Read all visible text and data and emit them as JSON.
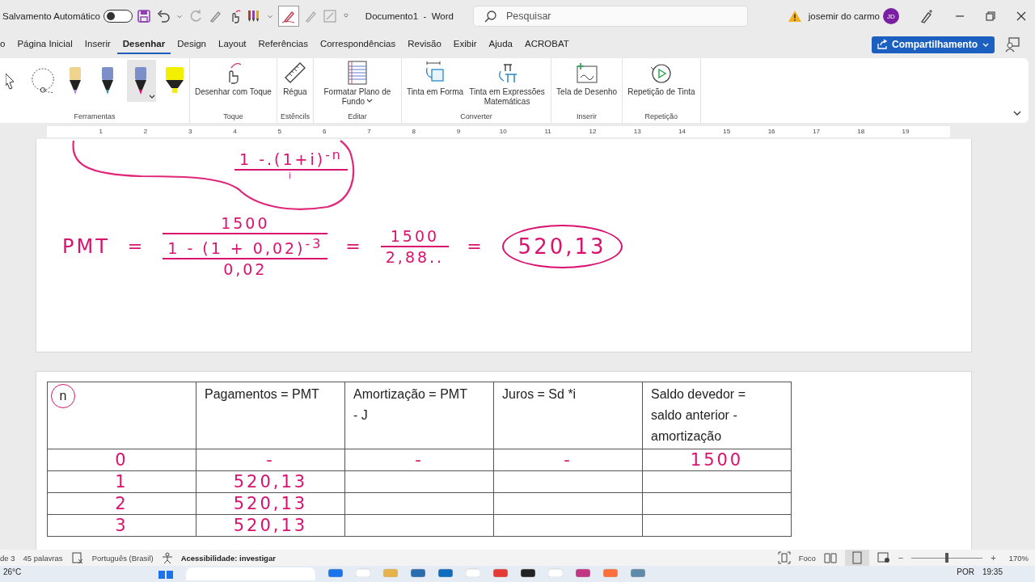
{
  "title_bar": {
    "autosave": {
      "label": "Salvamento Automático",
      "on": false
    },
    "document_title": "Documento1  -  Word",
    "search": {
      "placeholder": "Pesquisar"
    },
    "warning": true,
    "user": {
      "name": "josemir do carmo",
      "initials": "JD"
    }
  },
  "tabs": [
    {
      "label": "o",
      "selected": false
    },
    {
      "label": "Página Inicial",
      "selected": false
    },
    {
      "label": "Inserir",
      "selected": false
    },
    {
      "label": "Desenhar",
      "selected": true
    },
    {
      "label": "Design",
      "selected": false
    },
    {
      "label": "Layout",
      "selected": false
    },
    {
      "label": "Referências",
      "selected": false
    },
    {
      "label": "Correspondências",
      "selected": false
    },
    {
      "label": "Revisão",
      "selected": false
    },
    {
      "label": "Exibir",
      "selected": false
    },
    {
      "label": "Ajuda",
      "selected": false
    },
    {
      "label": "ACROBAT",
      "selected": false
    }
  ],
  "share_button": {
    "label": "Compartilhamento"
  },
  "ribbon": {
    "tools": {
      "label": "Ferramentas",
      "items": [
        {
          "kind": "select",
          "selected": false
        },
        {
          "kind": "lasso",
          "selected": false
        },
        {
          "kind": "pen",
          "color": "#b07fd8",
          "selected": false
        },
        {
          "kind": "pen",
          "color": "#3f8fa8",
          "selected": false
        },
        {
          "kind": "pen",
          "color": "#e6006e",
          "selected": true
        },
        {
          "kind": "highlighter",
          "color": "#f2f000",
          "selected": false
        }
      ]
    },
    "groups": [
      {
        "label": "Toque",
        "buttons": [
          {
            "label": "Desenhar com Toque"
          }
        ]
      },
      {
        "label": "Estêncils",
        "buttons": [
          {
            "label": "Régua"
          }
        ]
      },
      {
        "label": "Editar",
        "buttons": [
          {
            "label": "Formatar Plano de Fundo",
            "dropdown": true
          }
        ]
      },
      {
        "label": "Converter",
        "buttons": [
          {
            "label": "Tinta em Forma"
          },
          {
            "label": "Tinta em Expressões Matemáticas"
          }
        ]
      },
      {
        "label": "Inserir",
        "buttons": [
          {
            "label": "Tela de Desenho"
          }
        ]
      },
      {
        "label": "Repetição",
        "buttons": [
          {
            "label": "Repetição de Tinta"
          }
        ]
      }
    ]
  },
  "ruler": {
    "marks": [
      "1",
      "2",
      "3",
      "4",
      "5",
      "6",
      "7",
      "8",
      "9",
      "10",
      "11",
      "12",
      "13",
      "14",
      "15",
      "16",
      "17",
      "18",
      "19"
    ]
  },
  "ink": {
    "cut_formula": {
      "numerator": "1 -.(1+i)$^{-n}$",
      "denominator": "i"
    },
    "formula": [
      {
        "kind": "label",
        "text": "PMT"
      },
      {
        "kind": "equals",
        "text": "="
      },
      {
        "kind": "fraction",
        "numerator": "1500",
        "denominator": {
          "numerator": "1 - (1 + 0,02)$^{-3}$",
          "denominator": "0,02"
        }
      },
      {
        "kind": "equals",
        "text": "="
      },
      {
        "kind": "fraction",
        "numerator": "1500",
        "denominator": "2,88.."
      },
      {
        "kind": "equals",
        "text": "="
      },
      {
        "kind": "result",
        "text": "520,13",
        "circled": true
      }
    ]
  },
  "table": {
    "columns": [
      {
        "label": "n",
        "circled": true
      },
      {
        "label": "Pagamentos = PMT",
        "circled": false
      },
      {
        "label": "Amortização = PMT - J",
        "circled": false
      },
      {
        "label": "Juros = Sd *i",
        "circled": false
      },
      {
        "label": "Saldo devedor = saldo anterior - amortização",
        "circled": false
      }
    ],
    "rows": [
      [
        "0",
        "-",
        "-",
        "-",
        "1500"
      ],
      [
        "1",
        "520,13",
        "",
        "",
        ""
      ],
      [
        "2",
        "520,13",
        "",
        "",
        ""
      ],
      [
        "3",
        "520,13",
        "",
        "",
        ""
      ]
    ]
  },
  "status_bar": {
    "page": "de 3",
    "words": "45 palavras",
    "language": "Português (Brasil)",
    "accessibility": "Acessibilidade: investigar",
    "focus": "Foco",
    "zoom": {
      "level": 0.5,
      "label": "170%",
      "zoom_out": "−",
      "zoom_in": "+"
    }
  },
  "taskbar": {
    "weather": "26°C",
    "language": "POR",
    "time": "19:35"
  }
}
